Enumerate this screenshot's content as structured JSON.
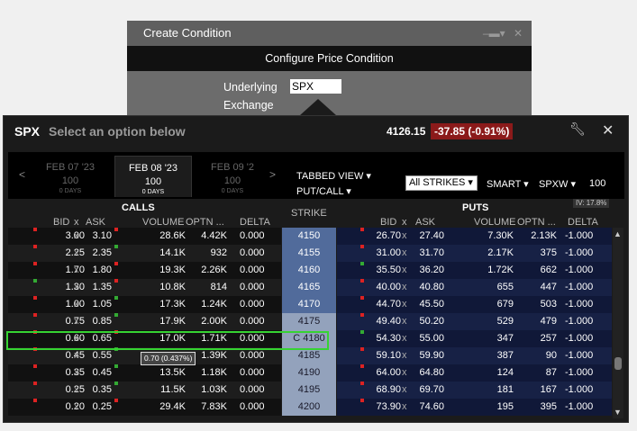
{
  "dialog": {
    "title": "Create Condition",
    "subtitle": "Configure Price Condition",
    "underlying_label": "Underlying",
    "underlying_value": "SPX",
    "exchange_label": "Exchange"
  },
  "chain": {
    "symbol": "SPX",
    "prompt": "Select an option below",
    "last": "4126.15",
    "change": "-37.85 (-0.91%)"
  },
  "expiries": [
    {
      "date": "FEB 07 '23",
      "mult": "100",
      "days": "0 DAYS"
    },
    {
      "date": "FEB 08 '23",
      "mult": "100",
      "days": "0 DAYS"
    },
    {
      "date": "FEB 09 '2",
      "mult": "100",
      "days": "0 DAYS"
    }
  ],
  "controls": {
    "tabbed_view": "TABBED VIEW",
    "put_call": "PUT/CALL",
    "strikes": "All STRIKES",
    "smart": "SMART",
    "trading_class": "SPXW",
    "multiplier": "100",
    "iv": "IV: 17.8%"
  },
  "headers": {
    "calls": "CALLS",
    "puts": "PUTS",
    "strike": "STRIKE",
    "bid": "BID",
    "x": "x",
    "ask": "ASK",
    "volume": "VOLUME",
    "optn": "OPTN ...",
    "delta": "DELTA"
  },
  "rows": [
    {
      "cb": "3.00",
      "ca": "3.10",
      "cv": "28.6K",
      "co": "4.42K",
      "cd": "0.000",
      "strike": "4150",
      "pb": "26.70",
      "pa": "27.40",
      "pv": "7.30K",
      "po": "2.13K",
      "pd": "-1.000"
    },
    {
      "cb": "2.25",
      "ca": "2.35",
      "cv": "14.1K",
      "co": "932",
      "cd": "0.000",
      "strike": "4155",
      "pb": "31.00",
      "pa": "31.70",
      "pv": "2.17K",
      "po": "375",
      "pd": "-1.000"
    },
    {
      "cb": "1.70",
      "ca": "1.80",
      "cv": "19.3K",
      "co": "2.26K",
      "cd": "0.000",
      "strike": "4160",
      "pb": "35.50",
      "pa": "36.20",
      "pv": "1.72K",
      "po": "662",
      "pd": "-1.000"
    },
    {
      "cb": "1.30",
      "ca": "1.35",
      "cv": "10.8K",
      "co": "814",
      "cd": "0.000",
      "strike": "4165",
      "pb": "40.00",
      "pa": "40.80",
      "pv": "655",
      "po": "447",
      "pd": "-1.000"
    },
    {
      "cb": "1.00",
      "ca": "1.05",
      "cv": "17.3K",
      "co": "1.24K",
      "cd": "0.000",
      "strike": "4170",
      "pb": "44.70",
      "pa": "45.50",
      "pv": "679",
      "po": "503",
      "pd": "-1.000"
    },
    {
      "cb": "0.75",
      "ca": "0.85",
      "cv": "17.9K",
      "co": "2.00K",
      "cd": "0.000",
      "strike": "4175",
      "pb": "49.40",
      "pa": "50.20",
      "pv": "529",
      "po": "479",
      "pd": "-1.000"
    },
    {
      "cb": "0.60",
      "ca": "0.65",
      "cv": "17.0K",
      "co": "1.71K",
      "cd": "0.000",
      "strike": "C 4180",
      "pb": "54.30",
      "pa": "55.00",
      "pv": "347",
      "po": "257",
      "pd": "-1.000"
    },
    {
      "cb": "0.45",
      "ca": "0.55",
      "cv": "",
      "co": "1.39K",
      "cd": "0.000",
      "strike": "4185",
      "pb": "59.10",
      "pa": "59.90",
      "pv": "387",
      "po": "90",
      "pd": "-1.000"
    },
    {
      "cb": "0.35",
      "ca": "0.45",
      "cv": "13.5K",
      "co": "1.18K",
      "cd": "0.000",
      "strike": "4190",
      "pb": "64.00",
      "pa": "64.80",
      "pv": "124",
      "po": "87",
      "pd": "-1.000"
    },
    {
      "cb": "0.25",
      "ca": "0.35",
      "cv": "11.5K",
      "co": "1.03K",
      "cd": "0.000",
      "strike": "4195",
      "pb": "68.90",
      "pa": "69.70",
      "pv": "181",
      "po": "167",
      "pd": "-1.000"
    },
    {
      "cb": "0.20",
      "ca": "0.25",
      "cv": "29.4K",
      "co": "7.83K",
      "cd": "0.000",
      "strike": "4200",
      "pb": "73.90",
      "pa": "74.60",
      "pv": "195",
      "po": "395",
      "pd": "-1.000"
    }
  ],
  "tooltip": "0.70 (0.437%)"
}
